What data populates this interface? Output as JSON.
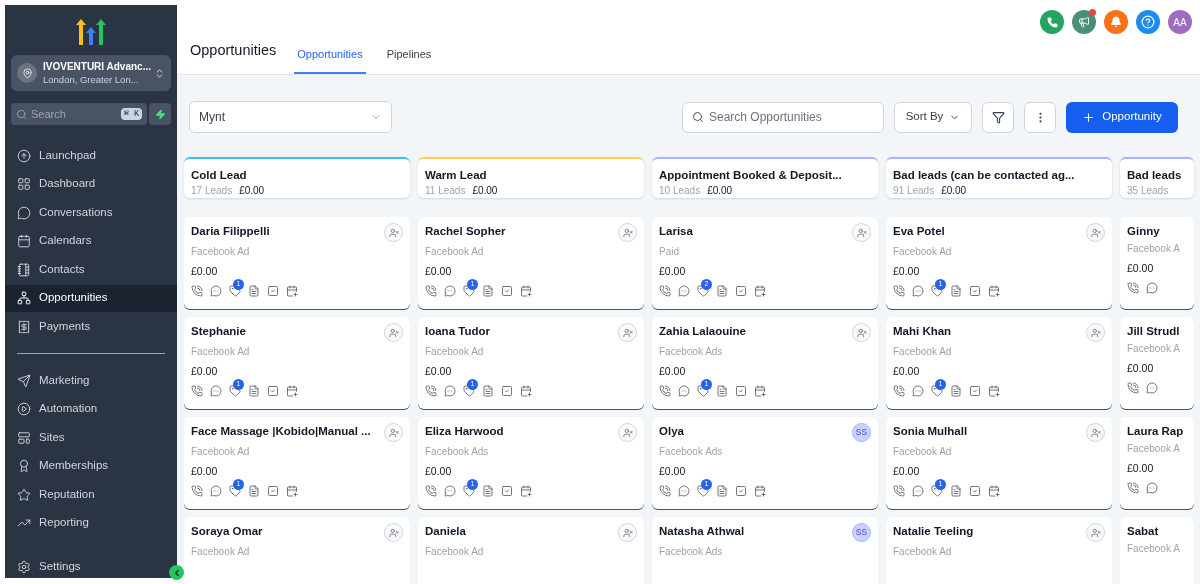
{
  "sidebar": {
    "account": {
      "name": "IVOVENTURI Advanc...",
      "location": "London, Greater Lon..."
    },
    "search": {
      "placeholder": "Search",
      "shortcut": "⌘ K"
    },
    "items": [
      {
        "label": "Launchpad",
        "selected": false
      },
      {
        "label": "Dashboard",
        "selected": false
      },
      {
        "label": "Conversations",
        "selected": false
      },
      {
        "label": "Calendars",
        "selected": false
      },
      {
        "label": "Contacts",
        "selected": false
      },
      {
        "label": "Opportunities",
        "selected": true
      },
      {
        "label": "Payments",
        "selected": false
      }
    ],
    "tool_items": [
      {
        "label": "Marketing",
        "selected": false
      },
      {
        "label": "Automation",
        "selected": false
      },
      {
        "label": "Sites",
        "selected": false
      },
      {
        "label": "Memberships",
        "selected": false
      },
      {
        "label": "Reputation",
        "selected": false
      },
      {
        "label": "Reporting",
        "selected": false
      }
    ],
    "settings": "Settings"
  },
  "header": {
    "title": "Opportunities",
    "tabs": [
      {
        "label": "Opportunities",
        "selected": true
      },
      {
        "label": "Pipelines",
        "selected": false
      }
    ],
    "user_initials": "AA",
    "announcement_unread": true
  },
  "toolbar": {
    "pipeline": "Mynt",
    "search_placeholder": "Search Opportunities",
    "sort": "Sort By",
    "add": "Opportunity"
  },
  "stages": [
    {
      "title": "Cold Lead",
      "count": "17 Leads",
      "total": "£0.00",
      "color": "#38bdf8",
      "partial": false,
      "cards": [
        {
          "name": "Daria Filippelli",
          "source": "Facebook Ad",
          "amount": "£0.00",
          "badge": "1"
        },
        {
          "name": "Stephanie",
          "source": "Facebook Ad",
          "amount": "£0.00",
          "badge": "1"
        },
        {
          "name": "Face Massage |Kobido|Manual ...",
          "source": "Facebook Ad",
          "amount": "£0.00",
          "badge": "1"
        },
        {
          "name": "Soraya Omar",
          "source": "Facebook Ad"
        }
      ]
    },
    {
      "title": "Warm Lead",
      "count": "11 Leads",
      "total": "£0.00",
      "color": "#fcd34d",
      "partial": false,
      "cards": [
        {
          "name": "Rachel Sopher",
          "source": "Facebook Ad",
          "amount": "£0.00",
          "badge": "1"
        },
        {
          "name": "Ioana Tudor",
          "source": "Facebook Ad",
          "amount": "£0.00",
          "badge": "1"
        },
        {
          "name": "Eliza Harwood",
          "source": "Facebook Ads",
          "amount": "£0.00",
          "badge": "1"
        },
        {
          "name": "Daniela",
          "source": "Facebook Ad"
        }
      ]
    },
    {
      "title": "Appointment Booked & Deposit...",
      "count": "10 Leads",
      "total": "£0.00",
      "color": "#a5b4fc",
      "partial": false,
      "cards": [
        {
          "name": "Larisa",
          "source": "Paid",
          "amount": "£0.00",
          "badge": "2"
        },
        {
          "name": "Zahia Lalaouine",
          "source": "Facebook Ads",
          "amount": "£0.00",
          "badge": "1"
        },
        {
          "name": "Olya",
          "source": "Facebook Ads",
          "amount": "£0.00",
          "badge": "1",
          "assignee": "SS"
        },
        {
          "name": "Natasha Athwal",
          "source": "Facebook Ads",
          "assignee": "SS"
        }
      ]
    },
    {
      "title": "Bad leads (can be contacted ag...",
      "count": "91 Leads",
      "total": "£0.00",
      "color": "#a5b4fc",
      "partial": false,
      "cards": [
        {
          "name": "Eva Potel",
          "source": "Facebook Ad",
          "amount": "£0.00",
          "badge": "1"
        },
        {
          "name": "Mahi Khan",
          "source": "Facebook Ad",
          "amount": "£0.00",
          "badge": "1"
        },
        {
          "name": "Sonia Mulhall",
          "source": "Facebook Ad",
          "amount": "£0.00",
          "badge": "1"
        },
        {
          "name": "Natalie Teeling",
          "source": "Facebook Ad"
        }
      ]
    },
    {
      "title": "Bad leads",
      "count": "35 Leads",
      "color": "#a5b4fc",
      "partial": true,
      "cards": [
        {
          "name": "Ginny",
          "source": "Facebook A",
          "amount": "£0.00"
        },
        {
          "name": "Jill Strudl",
          "source": "Facebook A",
          "amount": "£0.00"
        },
        {
          "name": "Laura Rap",
          "source": "Facebook A",
          "amount": "£0.00"
        },
        {
          "name": "Sabat",
          "source": "Facebook A"
        }
      ]
    }
  ]
}
